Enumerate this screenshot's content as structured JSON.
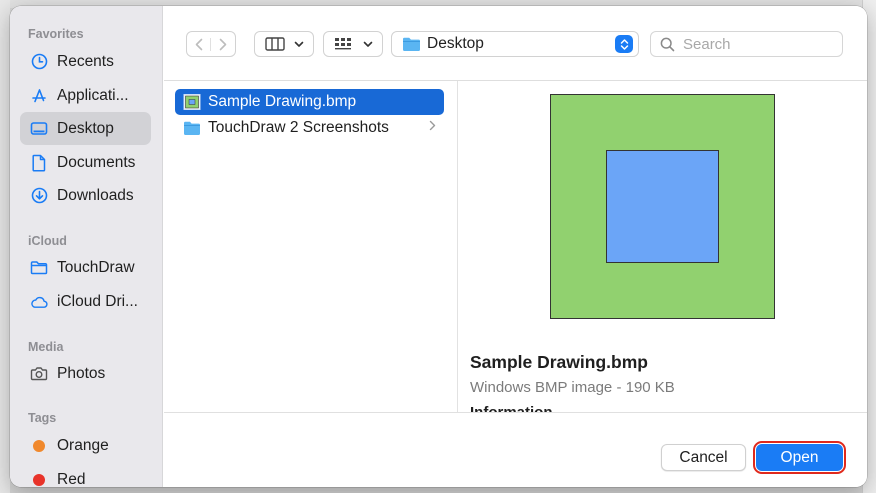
{
  "sidebar": {
    "sections": [
      {
        "title": "Favorites",
        "items": [
          {
            "label": "Recents",
            "icon": "clock-icon"
          },
          {
            "label": "Applicati...",
            "icon": "applications-icon"
          },
          {
            "label": "Desktop",
            "icon": "desktop-icon",
            "selected": true
          },
          {
            "label": "Documents",
            "icon": "document-icon"
          },
          {
            "label": "Downloads",
            "icon": "download-icon"
          }
        ]
      },
      {
        "title": "iCloud",
        "items": [
          {
            "label": "TouchDraw",
            "icon": "folder-icon"
          },
          {
            "label": "iCloud Dri...",
            "icon": "cloud-icon"
          }
        ]
      },
      {
        "title": "Media",
        "items": [
          {
            "label": "Photos",
            "icon": "camera-icon"
          }
        ]
      },
      {
        "title": "Tags",
        "items": [
          {
            "label": "Orange",
            "color": "#f0882c"
          },
          {
            "label": "Red",
            "color": "#e8332a"
          }
        ]
      }
    ]
  },
  "toolbar": {
    "location": "Desktop",
    "search_placeholder": "Search"
  },
  "browser": {
    "files": [
      {
        "name": "Sample Drawing.bmp",
        "icon": "bmp-file-icon",
        "selected": true
      },
      {
        "name": "TouchDraw 2 Screenshots",
        "icon": "folder-icon",
        "has_children": true
      }
    ]
  },
  "preview": {
    "name": "Sample Drawing.bmp",
    "kind": "Windows BMP image - 190 KB",
    "info_label": "Information"
  },
  "footer": {
    "cancel_label": "Cancel",
    "open_label": "Open"
  },
  "colors": {
    "accent": "#1a7cf5",
    "selection": "#1869d6",
    "highlight_outline": "#e0291c",
    "preview_green": "#91d16f",
    "preview_blue": "#6ba5f7"
  }
}
